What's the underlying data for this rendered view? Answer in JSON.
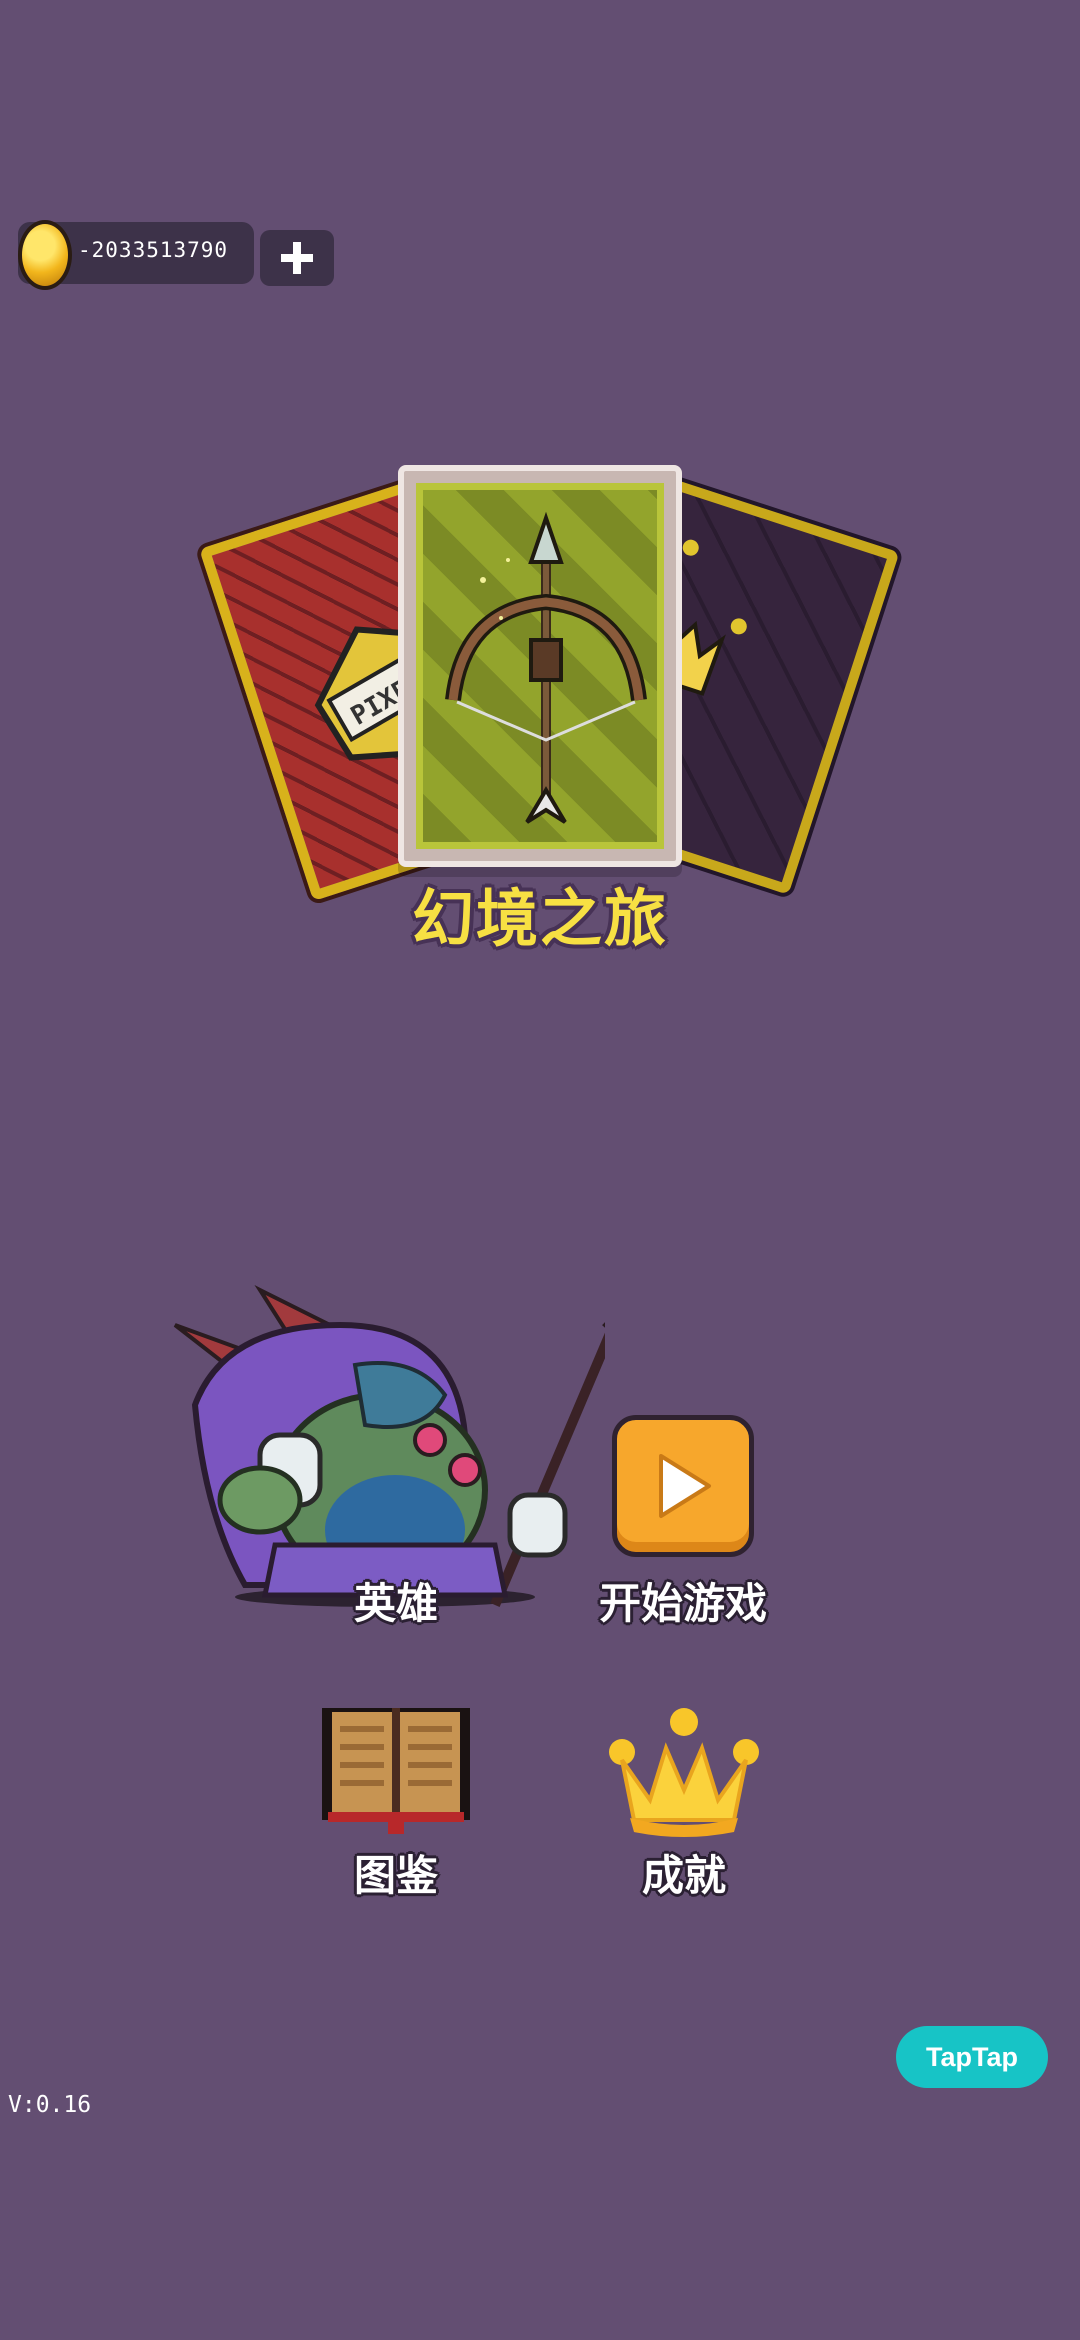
{
  "currency": {
    "amount": "-2033513790",
    "icon": "gold-coin-icon",
    "add_icon": "plus-icon"
  },
  "title": "幻境之旅",
  "cards": {
    "left_emblem": "PIXEL T",
    "center_icon": "crossbow-icon",
    "right_icon": "crown-icon"
  },
  "menu": {
    "heroes": {
      "label": "英雄",
      "icon": "hero-character-icon"
    },
    "start": {
      "label": "开始游戏",
      "icon": "play-icon",
      "color": "#f7a72c"
    },
    "codex": {
      "label": "图鉴",
      "icon": "book-icon"
    },
    "achievements": {
      "label": "成就",
      "icon": "crown-icon"
    }
  },
  "taptap": {
    "label": "TapTap",
    "color": "#17c4c6"
  },
  "version": "V:0.16",
  "colors": {
    "background": "#634e72",
    "title": "#f7e043"
  }
}
